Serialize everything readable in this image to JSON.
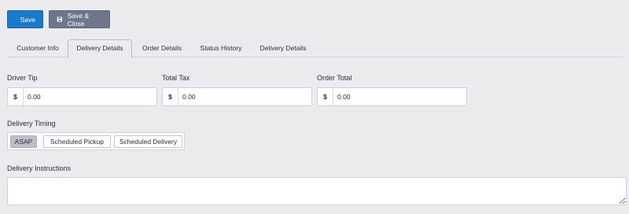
{
  "toolbar": {
    "save_label": "Save",
    "save_close_label": "Save & Close"
  },
  "tabs": [
    {
      "label": "Customer Info",
      "active": false
    },
    {
      "label": "Delivery Details",
      "active": true
    },
    {
      "label": "Order Details",
      "active": false
    },
    {
      "label": "Status History",
      "active": false
    },
    {
      "label": "Delivery Details",
      "active": false
    }
  ],
  "fields": {
    "driver_tip": {
      "label": "Driver Tip",
      "currency": "$",
      "value": "0.00"
    },
    "total_tax": {
      "label": "Total Tax",
      "currency": "$",
      "value": "0.00"
    },
    "order_total": {
      "label": "Order Total",
      "currency": "$",
      "value": "0.00"
    }
  },
  "timing": {
    "label": "Delivery Timing",
    "options": [
      "ASAP",
      "Scheduled Pickup",
      "Scheduled Delivery"
    ],
    "selected": "ASAP"
  },
  "instructions": {
    "label": "Delivery Instructions",
    "value": ""
  },
  "colors": {
    "primary": "#1a7ac7",
    "secondary": "#6e778c",
    "background": "#ebebf0"
  },
  "icons": {
    "save": "floppy-disk-icon"
  }
}
